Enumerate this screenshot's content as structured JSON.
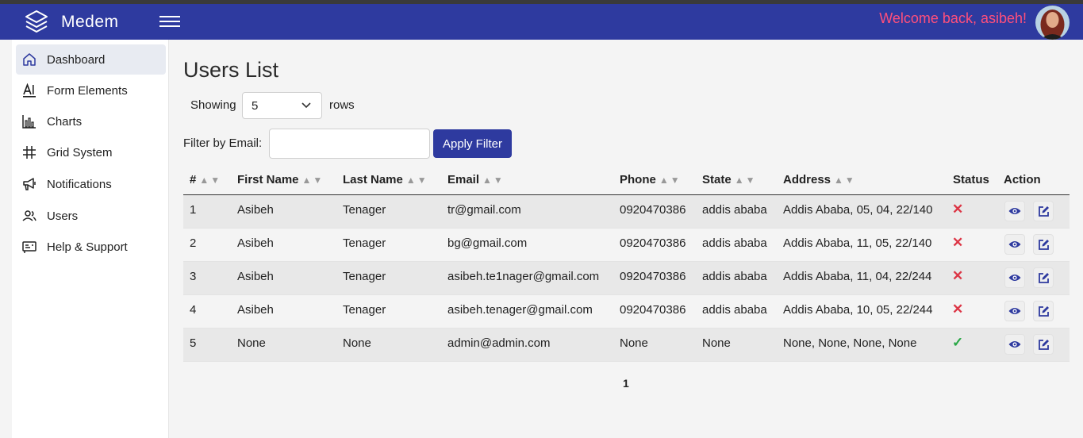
{
  "header": {
    "brand": "Medem",
    "welcome": "Welcome back, asibeh!"
  },
  "sidebar": {
    "items": [
      {
        "label": "Dashboard",
        "icon": "home-icon"
      },
      {
        "label": "Form Elements",
        "icon": "text-format-icon"
      },
      {
        "label": "Charts",
        "icon": "bar-chart-icon"
      },
      {
        "label": "Grid System",
        "icon": "grid-icon"
      },
      {
        "label": "Notifications",
        "icon": "megaphone-icon"
      },
      {
        "label": "Users",
        "icon": "users-icon"
      },
      {
        "label": "Help & Support",
        "icon": "support-card-icon"
      }
    ]
  },
  "main": {
    "title": "Users List",
    "showing_label": "Showing",
    "rows_value": "5",
    "rows_label": "rows",
    "filter_label": "Filter by Email:",
    "filter_value": "",
    "apply_label": "Apply Filter"
  },
  "table": {
    "sort_glyph": "▲▼",
    "columns": [
      "#",
      "First Name",
      "Last Name",
      "Email",
      "Phone",
      "State",
      "Address",
      "Status",
      "Action"
    ],
    "rows": [
      {
        "id": "1",
        "first": "Asibeh",
        "last": "Tenager",
        "email": "tr@gmail.com",
        "phone": "0920470386",
        "state": "addis ababa",
        "address": "Addis Ababa, 05, 04, 22/140",
        "status": "inactive"
      },
      {
        "id": "2",
        "first": "Asibeh",
        "last": "Tenager",
        "email": "bg@gmail.com",
        "phone": "0920470386",
        "state": "addis ababa",
        "address": "Addis Ababa, 11, 05, 22/140",
        "status": "inactive"
      },
      {
        "id": "3",
        "first": "Asibeh",
        "last": "Tenager",
        "email": "asibeh.te1nager@gmail.com",
        "phone": "0920470386",
        "state": "addis ababa",
        "address": "Addis Ababa, 11, 04, 22/244",
        "status": "inactive"
      },
      {
        "id": "4",
        "first": "Asibeh",
        "last": "Tenager",
        "email": "asibeh.tenager@gmail.com",
        "phone": "0920470386",
        "state": "addis ababa",
        "address": "Addis Ababa, 10, 05, 22/244",
        "status": "inactive"
      },
      {
        "id": "5",
        "first": "None",
        "last": "None",
        "email": "admin@admin.com",
        "phone": "None",
        "state": "None",
        "address": "None, None, None, None",
        "status": "active"
      }
    ]
  },
  "pagination": {
    "current": "1"
  },
  "colors": {
    "primary": "#2e3a9f",
    "welcome": "#ff4f7b",
    "status_inactive": "#dc3545",
    "status_active": "#28a745"
  }
}
